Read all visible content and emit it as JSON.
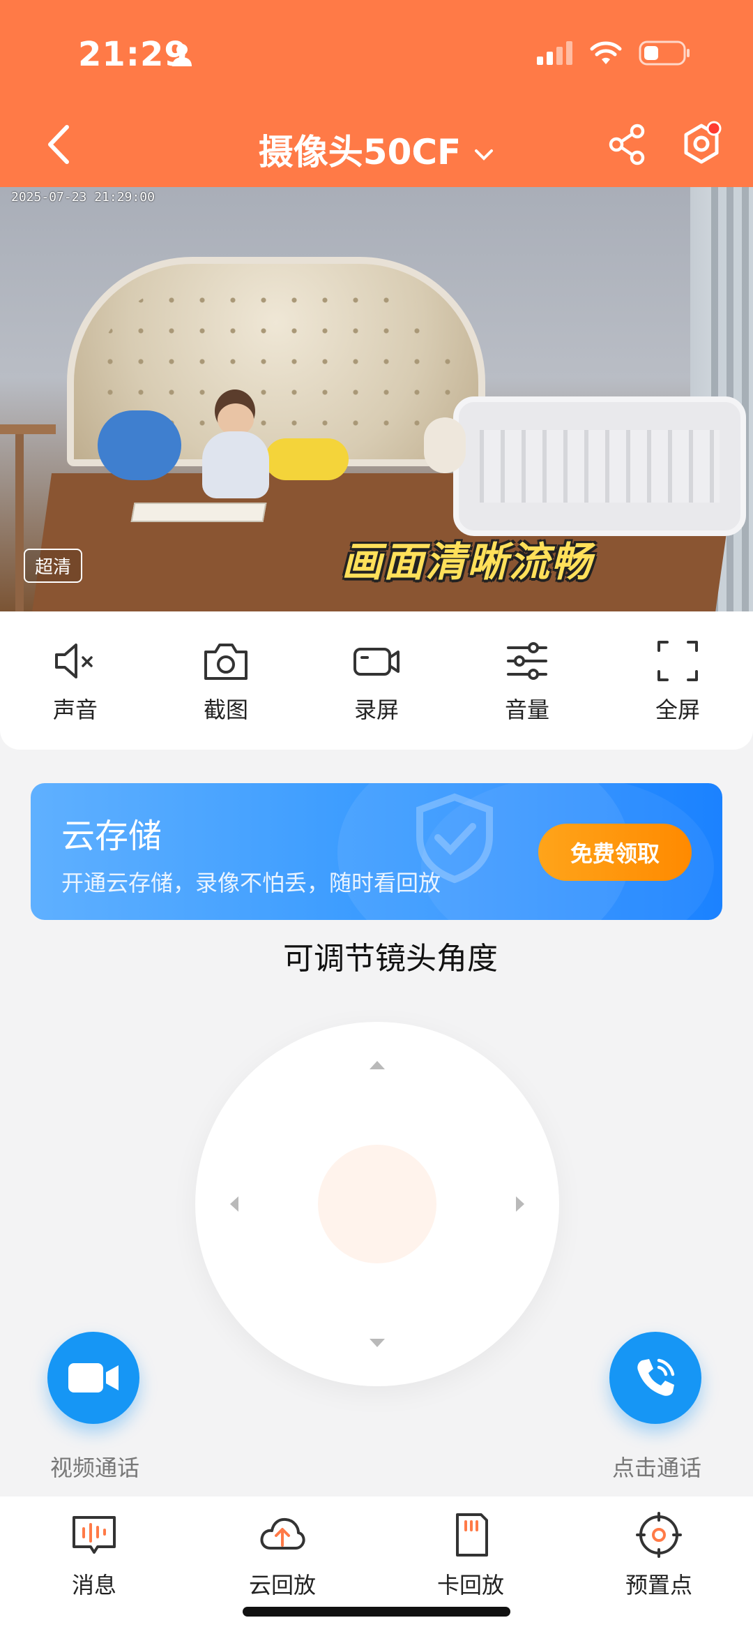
{
  "status_bar": {
    "time": "21:29"
  },
  "nav": {
    "title": "摄像头50CF"
  },
  "video": {
    "timestamp": "2025-07-23 21:29:00",
    "quality_badge": "超清",
    "caption": "画面清晰流畅"
  },
  "controls": [
    {
      "label": "声音",
      "icon": "speaker-mute-icon"
    },
    {
      "label": "截图",
      "icon": "camera-icon"
    },
    {
      "label": "录屏",
      "icon": "video-record-icon"
    },
    {
      "label": "音量",
      "icon": "sliders-icon"
    },
    {
      "label": "全屏",
      "icon": "fullscreen-icon"
    }
  ],
  "cloud_storage": {
    "title": "云存储",
    "subtitle": "开通云存储，录像不怕丢，随时看回放",
    "button": "免费领取"
  },
  "ptz": {
    "label": "可调节镜头角度"
  },
  "calls": {
    "video_label": "视频通话",
    "phone_label": "点击通话"
  },
  "bottom_nav": [
    {
      "label": "消息",
      "icon": "message-icon"
    },
    {
      "label": "云回放",
      "icon": "cloud-upload-icon"
    },
    {
      "label": "卡回放",
      "icon": "sd-card-icon"
    },
    {
      "label": "预置点",
      "icon": "target-icon"
    }
  ],
  "colors": {
    "header": "#ff7a47",
    "accent_blue": "#1696f5",
    "accent_orange": "#ff8a00"
  }
}
